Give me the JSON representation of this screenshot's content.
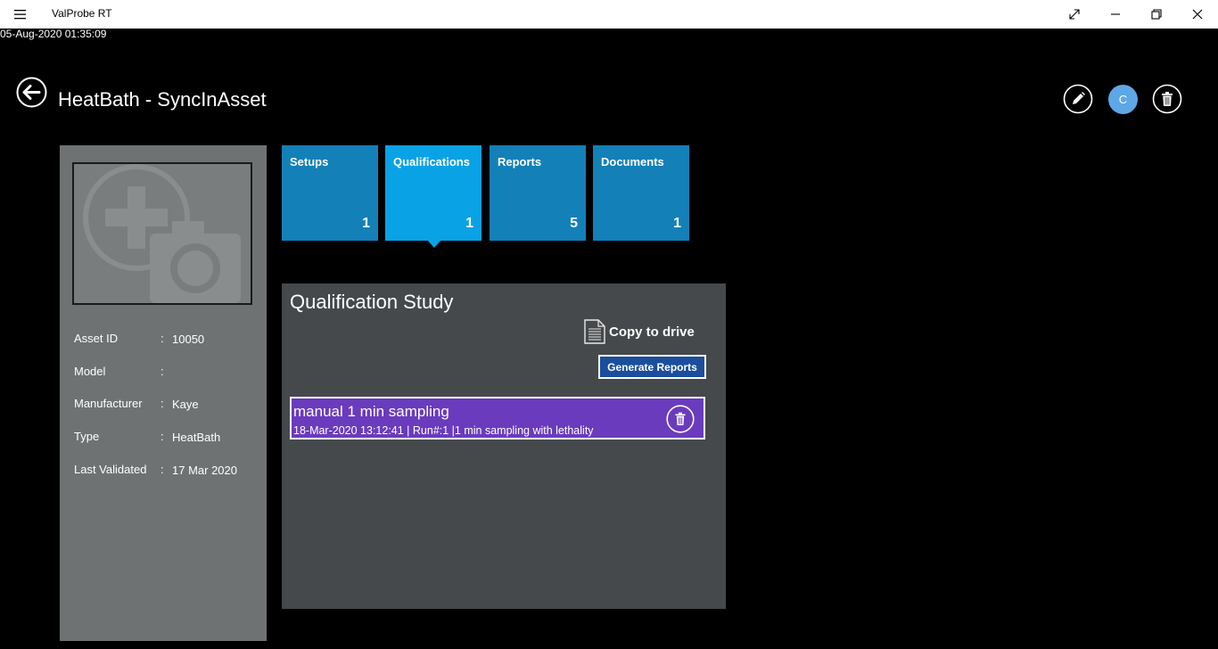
{
  "window": {
    "app_title": "ValProbe RT",
    "menu_icon": "hamburger-icon",
    "controls": [
      "expand-icon",
      "minimize-icon",
      "restore-icon",
      "close-icon"
    ]
  },
  "timestamp": "05-Aug-2020 01:35:09",
  "header": {
    "title": "HeatBath - SyncInAsset",
    "avatar_initial": "C"
  },
  "asset": {
    "fields": [
      {
        "label": "Asset ID",
        "value": "10050"
      },
      {
        "label": "Model",
        "value": ""
      },
      {
        "label": "Manufacturer",
        "value": "Kaye"
      },
      {
        "label": "Type",
        "value": "HeatBath"
      },
      {
        "label": "Last Validated",
        "value": "17 Mar 2020"
      }
    ],
    "separator": ":"
  },
  "tiles": [
    {
      "label": "Setups",
      "count": "1"
    },
    {
      "label": "Qualifications",
      "count": "1"
    },
    {
      "label": "Reports",
      "count": "5"
    },
    {
      "label": "Documents",
      "count": "1"
    }
  ],
  "qualification": {
    "title": "Qualification Study",
    "copy_label": "Copy to drive",
    "generate_label": "Generate Reports",
    "items": [
      {
        "name": "manual 1 min sampling",
        "detail": "18-Mar-2020 13:12:41 | Run#:1 |1 min sampling with lethality"
      }
    ]
  },
  "colors": {
    "tile": "#1380b8",
    "tile_active": "#09a2e4",
    "study_item": "#6a3bbd",
    "generate_button": "#1b4e9c",
    "avatar": "#5ea7e6"
  }
}
